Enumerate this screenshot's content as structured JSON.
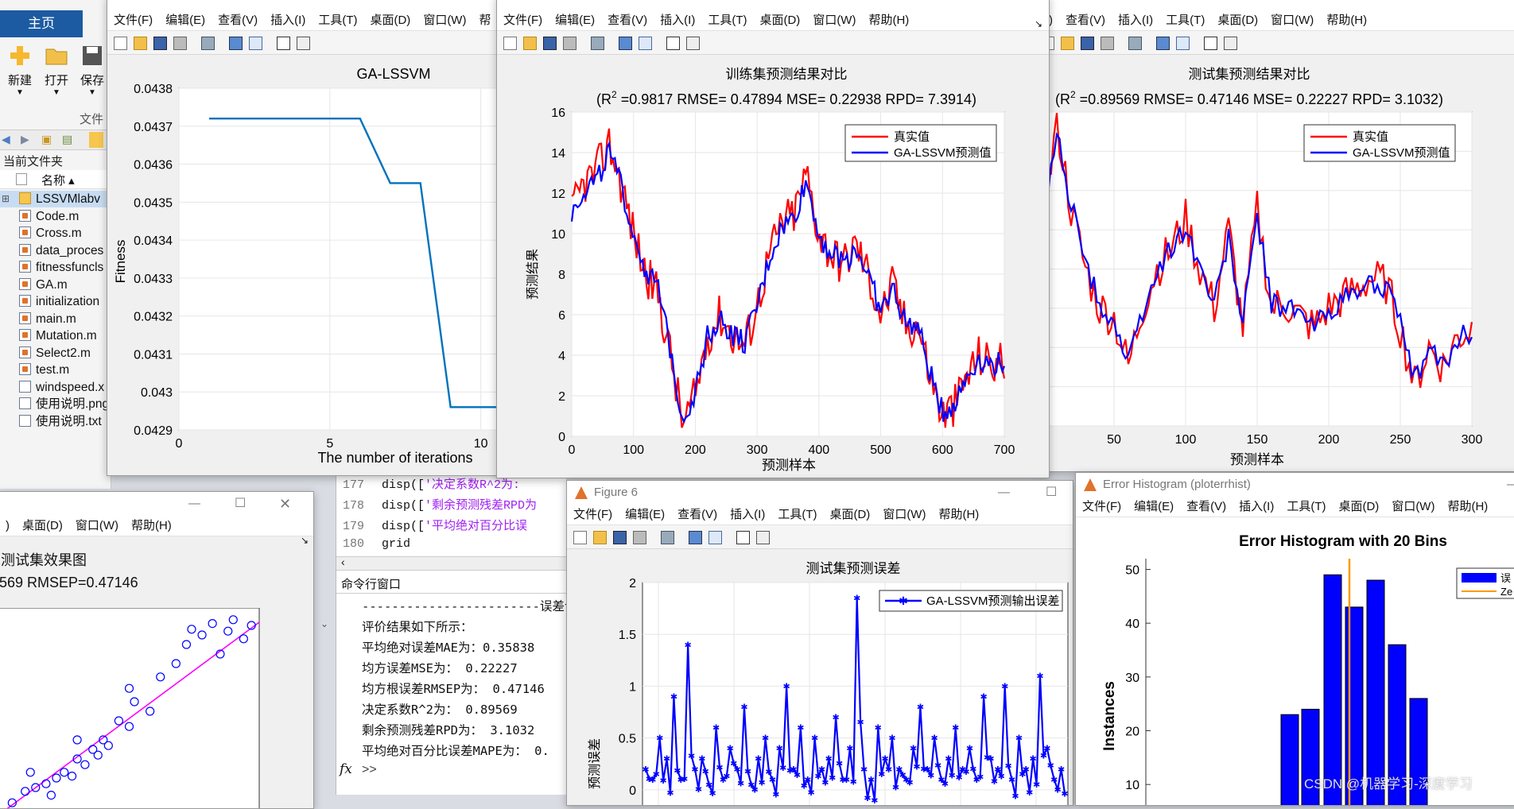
{
  "matlab": {
    "home_tab": "主页",
    "btn_new": "新建",
    "btn_open": "打开",
    "btn_save": "保存",
    "section_file": "文件",
    "current_folder_title": "当前文件夹",
    "col_name": "名称",
    "files": [
      "LSSVMlabv",
      "Code.m",
      "Cross.m",
      "data_proces",
      "fitnessfuncls",
      "GA.m",
      "initialization",
      "main.m",
      "Mutation.m",
      "Select2.m",
      "test.m",
      "windspeed.x",
      "使用说明.png",
      "使用说明.txt"
    ]
  },
  "menus": {
    "full": [
      "文件(F)",
      "编辑(E)",
      "查看(V)",
      "插入(I)",
      "工具(T)",
      "桌面(D)",
      "窗口(W)",
      "帮助(H)"
    ],
    "fig1": [
      "文件(F)",
      "编辑(E)",
      "查看(V)",
      "插入(I)",
      "工具(T)",
      "桌面(D)",
      "窗口(W)",
      "帮"
    ],
    "fig3": [
      "E)",
      "查看(V)",
      "插入(I)",
      "工具(T)",
      "桌面(D)",
      "窗口(W)",
      "帮助(H)"
    ],
    "fig4": [
      ")",
      "桌面(D)",
      "窗口(W)",
      "帮助(H)"
    ]
  },
  "fig1": {
    "chart_data": {
      "type": "line",
      "title": "GA-LSSVM",
      "xlabel": "The number of iterations",
      "ylabel": "Fitness",
      "xlim": [
        0,
        10.8
      ],
      "ylim": [
        0.0429,
        0.0438
      ],
      "xticks": [
        "0",
        "5",
        "10"
      ],
      "yticks": [
        "0.0438",
        "0.0437",
        "0.0436",
        "0.0435",
        "0.0434",
        "0.0433",
        "0.0432",
        "0.0431",
        "0.043",
        "0.0429"
      ],
      "series": [
        {
          "x": [
            1,
            2,
            3,
            4,
            5,
            6,
            7,
            8,
            9,
            10,
            11
          ],
          "y": [
            0.04372,
            0.04372,
            0.04372,
            0.04372,
            0.04372,
            0.04372,
            0.04355,
            0.04355,
            0.04296,
            0.04296,
            0.04296
          ]
        }
      ],
      "color": "#0072bd"
    }
  },
  "fig2": {
    "title_line1": "训练集预测结果对比",
    "title_line2_prefix": "(R",
    "title_line2_rest": " =0.9817 RMSE= 0.47894 MSE= 0.22938 RPD= 7.3914)",
    "sup": "2",
    "xlabel": "预测样本",
    "ylabel": "预测结果",
    "legend": [
      "真实值",
      "GA-LSSVM预测值"
    ],
    "chart_data": {
      "type": "line",
      "xlim": [
        0,
        700
      ],
      "ylim": [
        0,
        16
      ],
      "xticks": [
        "0",
        "100",
        "200",
        "300",
        "400",
        "500",
        "600",
        "700"
      ],
      "yticks": [
        "0",
        "2",
        "4",
        "6",
        "8",
        "10",
        "12",
        "14",
        "16"
      ],
      "x": [
        0,
        20,
        40,
        60,
        80,
        100,
        120,
        140,
        160,
        180,
        200,
        220,
        240,
        260,
        280,
        300,
        320,
        340,
        360,
        380,
        400,
        420,
        440,
        460,
        480,
        500,
        520,
        540,
        560,
        580,
        600,
        620,
        640,
        660,
        680,
        700
      ],
      "series": [
        {
          "name": "真实值",
          "color": "#ff0000",
          "values": [
            11,
            12.5,
            13,
            14.5,
            12.5,
            10,
            8,
            7,
            4,
            0.5,
            2,
            5,
            6,
            5,
            4.5,
            6.5,
            9,
            10.5,
            11,
            13,
            10,
            9,
            8.5,
            9.5,
            8,
            6,
            7.5,
            5.5,
            5.5,
            3,
            1,
            1.5,
            3,
            4,
            3.5,
            3.8
          ]
        },
        {
          "name": "GA-LSSVM预测值",
          "color": "#0000ff",
          "values": [
            11,
            12.2,
            12.6,
            14,
            12.3,
            10,
            8.2,
            7.2,
            4.2,
            0.8,
            2.2,
            5,
            5.8,
            5,
            4.6,
            6.4,
            8.8,
            10.3,
            10.8,
            12.6,
            10,
            9,
            8.6,
            9.3,
            8,
            6.1,
            7.3,
            5.6,
            5.4,
            3.1,
            1.2,
            1.6,
            3,
            3.9,
            3.5,
            3.7
          ]
        }
      ]
    }
  },
  "fig3": {
    "title_line1": "测试集预测结果对比",
    "title_line2_prefix": "(R",
    "title_line2_rest": " =0.89569 RMSE= 0.47146 MSE= 0.22227 RPD= 3.1032)",
    "sup": "2",
    "xlabel": "预测样本",
    "legend": [
      "真实值",
      "GA-LSSVM预测值"
    ],
    "chart_data": {
      "type": "line",
      "xlim": [
        0,
        300
      ],
      "xticks": [
        "50",
        "100",
        "150",
        "200",
        "250",
        "300"
      ],
      "x": [
        0,
        10,
        20,
        30,
        40,
        50,
        60,
        70,
        80,
        90,
        100,
        110,
        120,
        130,
        140,
        150,
        160,
        170,
        180,
        190,
        200,
        210,
        220,
        230,
        240,
        250,
        260,
        270,
        280,
        290,
        300
      ],
      "series": [
        {
          "name": "真实值",
          "color": "#ff0000",
          "values": [
            10,
            15.5,
            11,
            8,
            6,
            5.5,
            3,
            6,
            8,
            9,
            10.5,
            8,
            6,
            10,
            5,
            11,
            6,
            6.2,
            5.5,
            5,
            6,
            6.5,
            7,
            7.5,
            7.2,
            5,
            2,
            4,
            3,
            4.5,
            5
          ]
        },
        {
          "name": "GA-LSSVM预测值",
          "color": "#0000ff",
          "values": [
            10,
            15,
            11.3,
            8.3,
            6.2,
            5.3,
            3.2,
            5.8,
            7.8,
            9,
            10.2,
            8.1,
            6.2,
            9.6,
            5.2,
            10.8,
            6.1,
            6.2,
            5.6,
            5.1,
            5.9,
            6.4,
            6.9,
            7.3,
            7.1,
            5.1,
            2.3,
            3.9,
            3.1,
            4.4,
            4.9
          ]
        }
      ]
    }
  },
  "fig4": {
    "title_line1": "测试集效果图",
    "title_line2": "569  RMSEP=0.47146",
    "controls": [
      "—",
      "☐",
      "✕"
    ],
    "chart_data": {
      "type": "scatter",
      "points": [
        [
          0.05,
          0.02
        ],
        [
          0.1,
          0.08
        ],
        [
          0.14,
          0.1
        ],
        [
          0.18,
          0.12
        ],
        [
          0.2,
          0.06
        ],
        [
          0.22,
          0.15
        ],
        [
          0.25,
          0.18
        ],
        [
          0.28,
          0.16
        ],
        [
          0.3,
          0.25
        ],
        [
          0.33,
          0.22
        ],
        [
          0.36,
          0.3
        ],
        [
          0.38,
          0.27
        ],
        [
          0.4,
          0.35
        ],
        [
          0.42,
          0.32
        ],
        [
          0.46,
          0.45
        ],
        [
          0.5,
          0.42
        ],
        [
          0.52,
          0.55
        ],
        [
          0.58,
          0.5
        ],
        [
          0.62,
          0.68
        ],
        [
          0.68,
          0.75
        ],
        [
          0.72,
          0.85
        ],
        [
          0.78,
          0.9
        ],
        [
          0.82,
          0.96
        ],
        [
          0.85,
          0.8
        ],
        [
          0.88,
          0.92
        ],
        [
          0.9,
          0.98
        ],
        [
          0.94,
          0.88
        ],
        [
          0.97,
          0.95
        ],
        [
          0.3,
          0.35
        ],
        [
          0.12,
          0.18
        ],
        [
          0.5,
          0.62
        ],
        [
          0.74,
          0.93
        ]
      ]
    }
  },
  "editor": {
    "lines": [
      {
        "num": "177",
        "pre": "disp([",
        "str": "'决定系数R^2为:",
        "post": ""
      },
      {
        "num": "178",
        "pre": "disp([",
        "str": "'剩余预测残差RPD为",
        "post": ""
      },
      {
        "num": "179",
        "pre": "disp([",
        "str": "'平均绝对百分比误",
        "post": ""
      },
      {
        "num": "180",
        "pre": "grid",
        "str": "",
        "post": ""
      }
    ]
  },
  "cmd": {
    "title": "命令行窗口",
    "lines": [
      "------------------------误差计",
      "评价结果如下所示：",
      "平均绝对误差MAE为：0.35838",
      "均方误差MSE为：       0.22227",
      "均方根误差RMSEP为：   0.47146",
      "决定系数R^2为：    0.89569",
      "剩余预测残差RPD为：   3.1032",
      "平均绝对百分比误差MAPE为：   0."
    ],
    "prompt_fx": "fx",
    "prompt": ">>"
  },
  "fig6": {
    "window_title": "Figure 6",
    "title": "测试集预测误差",
    "ylabel": "预测误差",
    "legend": "GA-LSSVM预测输出误差",
    "chart_data": {
      "type": "line",
      "ylim": [
        -0.3,
        2
      ],
      "yticks": [
        "2",
        "1.5",
        "1",
        "0.5",
        "0"
      ],
      "values": [
        0.2,
        0.1,
        0.5,
        0.3,
        0.9,
        0.1,
        1.4,
        0.2,
        0.3,
        0.05,
        0.6,
        0.1,
        0.4,
        0.2,
        0.8,
        0.05,
        0.3,
        0.5,
        0.1,
        0.4,
        1.0,
        0.2,
        0.6,
        0.1,
        0.5,
        0.2,
        0.3,
        0.7,
        0.1,
        0.4,
        1.85,
        0.2,
        0.1,
        0.6,
        0.3,
        0.5,
        0.2,
        0.1,
        0.4,
        0.8,
        0.2,
        0.5,
        0.1,
        0.3,
        0.6,
        0.2,
        0.4,
        0.1,
        0.9,
        0.3,
        0.2,
        1.0,
        0.1,
        0.5,
        0.2,
        0.3,
        1.1,
        0.4,
        0.1,
        0.2
      ],
      "color": "#0000ff"
    }
  },
  "fig7": {
    "window_title": "Error Histogram (ploterrhist)",
    "title": "Error Histogram with 20 Bins",
    "ylabel": "Instances",
    "legend": [
      "误",
      "Ze"
    ],
    "chart_data": {
      "type": "bar",
      "yticks": [
        "50",
        "40",
        "30",
        "20",
        "10"
      ],
      "values": [
        23,
        24,
        49,
        43,
        48,
        36,
        26
      ],
      "zero_line_color": "#ff9900",
      "bar_color": "#0000ff"
    }
  },
  "watermark": "CSDN @机器学习-深度学习"
}
